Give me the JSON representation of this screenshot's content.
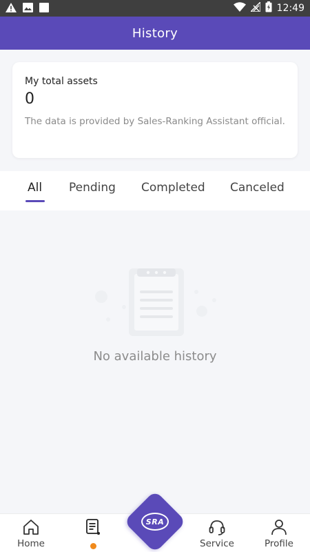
{
  "status_bar": {
    "time": "12:49",
    "left_icons": [
      "warning-icon",
      "image-icon",
      "square-icon"
    ],
    "right_icons": [
      "wifi-icon",
      "no-signal-icon",
      "battery-icon"
    ]
  },
  "header": {
    "title": "History"
  },
  "assets": {
    "label": "My total assets",
    "value": "0",
    "note": "The data is provided by Sales-Ranking Assistant official."
  },
  "tabs": [
    {
      "label": "All",
      "active": true
    },
    {
      "label": "Pending",
      "active": false
    },
    {
      "label": "Completed",
      "active": false
    },
    {
      "label": "Canceled",
      "active": false
    }
  ],
  "empty_state": {
    "text": "No available history",
    "icon": "clipboard-icon"
  },
  "bottom_nav": {
    "items": [
      {
        "label": "Home",
        "icon": "home-icon"
      },
      {
        "label": "",
        "icon": "orders-icon",
        "badge_dot": true
      },
      {
        "label": "Service",
        "icon": "headset-icon"
      },
      {
        "label": "Profile",
        "icon": "person-icon"
      }
    ],
    "center_logo": "SRA"
  },
  "colors": {
    "primary": "#5a4ab8",
    "dot": "#f08a1c",
    "background": "#f5f6f9"
  }
}
